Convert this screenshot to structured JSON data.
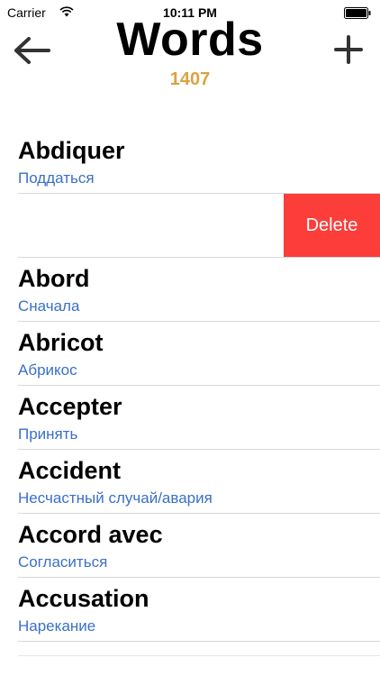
{
  "status_bar": {
    "carrier": "Carrier",
    "time": "10:11 PM"
  },
  "header": {
    "title": "Words",
    "count": "1407",
    "count_color": "#d9a441",
    "back_icon": "arrow-left-icon",
    "add_icon": "plus-icon"
  },
  "words": [
    {
      "word": "Abdiquer",
      "translation": "Поддаться"
    },
    {
      "word": "",
      "translation": "",
      "swiped": true,
      "delete_label": "Delete"
    },
    {
      "word": "Abord",
      "translation": "Сначала"
    },
    {
      "word": "Abricot",
      "translation": "Абрикос"
    },
    {
      "word": "Accepter",
      "translation": "Принять"
    },
    {
      "word": "Accident",
      "translation": "Несчастный случай/авария"
    },
    {
      "word": "Accord avec",
      "translation": "Согласиться"
    },
    {
      "word": "Accusation",
      "translation": "Нарекание"
    }
  ],
  "colors": {
    "translation": "#3a6fc9",
    "delete": "#fc3d39"
  }
}
